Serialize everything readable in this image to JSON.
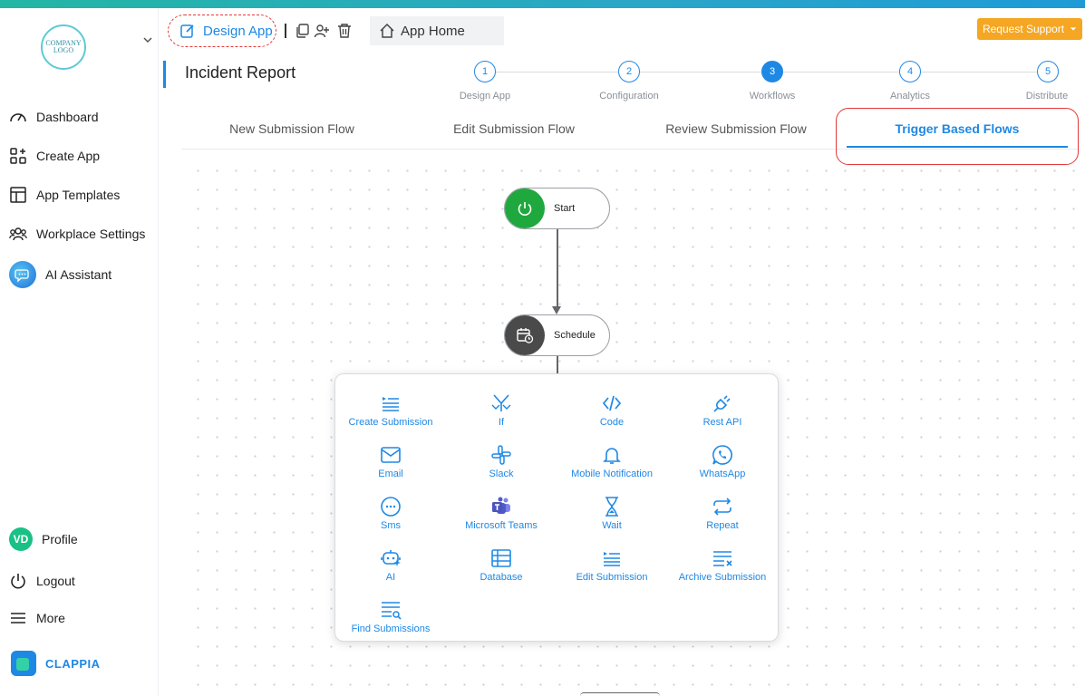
{
  "sidebar": {
    "logo_text": "COMPANY LOGO",
    "nav": [
      {
        "label": "Dashboard",
        "icon": "gauge-icon"
      },
      {
        "label": "Create App",
        "icon": "create-app-icon"
      },
      {
        "label": "App Templates",
        "icon": "templates-icon"
      },
      {
        "label": "Workplace Settings",
        "icon": "users-icon"
      },
      {
        "label": "AI Assistant",
        "icon": "ai-assistant-icon"
      }
    ],
    "profile": {
      "initials": "VD",
      "label": "Profile"
    },
    "logout_label": "Logout",
    "more_label": "More",
    "brand": "CLAPPIA"
  },
  "header": {
    "design_app_label": "Design App",
    "app_home_label": "App Home",
    "request_support_label": "Request Support"
  },
  "page": {
    "title": "Incident Report"
  },
  "stepper": [
    {
      "number": "1",
      "label": "Design App",
      "active": false
    },
    {
      "number": "2",
      "label": "Configuration",
      "active": false
    },
    {
      "number": "3",
      "label": "Workflows",
      "active": true
    },
    {
      "number": "4",
      "label": "Analytics",
      "active": false
    },
    {
      "number": "5",
      "label": "Distribute",
      "active": false
    }
  ],
  "tabs": [
    {
      "label": "New Submission Flow"
    },
    {
      "label": "Edit Submission Flow"
    },
    {
      "label": "Review Submission Flow"
    },
    {
      "label": "Trigger Based Flows",
      "active": true
    }
  ],
  "flow": {
    "start_label": "Start",
    "schedule_label": "Schedule"
  },
  "actions": [
    {
      "label": "Create Submission"
    },
    {
      "label": "If"
    },
    {
      "label": "Code"
    },
    {
      "label": "Rest API"
    },
    {
      "label": "Email"
    },
    {
      "label": "Slack"
    },
    {
      "label": "Mobile Notification"
    },
    {
      "label": "WhatsApp"
    },
    {
      "label": "Sms"
    },
    {
      "label": "Microsoft Teams"
    },
    {
      "label": "Wait"
    },
    {
      "label": "Repeat"
    },
    {
      "label": "AI"
    },
    {
      "label": "Database"
    },
    {
      "label": "Edit Submission"
    },
    {
      "label": "Archive Submission"
    },
    {
      "label": "Find Submissions"
    }
  ],
  "colors": {
    "accent": "#1e88e5",
    "start_green": "#1fa83e",
    "schedule_dark": "#4a4a4a",
    "support_orange": "#f5a623",
    "highlight_red": "#e23a3a"
  }
}
